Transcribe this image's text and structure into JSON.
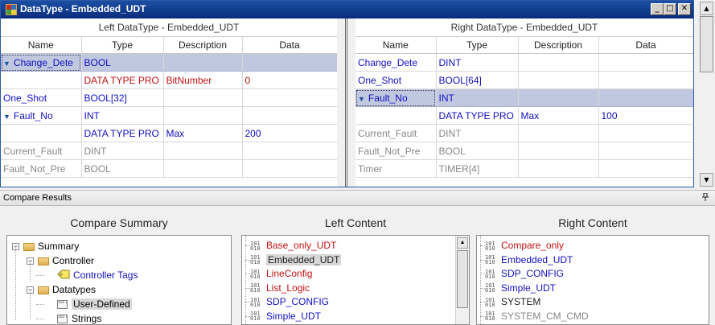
{
  "window": {
    "title": "DataType - Embedded_UDT",
    "minimize_label": "_",
    "maximize_label": "□",
    "close_label": "✕"
  },
  "left_panel": {
    "header": "Left DataType - Embedded_UDT",
    "columns": [
      "Name",
      "Type",
      "Description",
      "Data"
    ],
    "rows": [
      {
        "name": "Change_Dete",
        "type": "BOOL",
        "description": "",
        "data": "",
        "expanded": true,
        "selected": true,
        "color": "blue"
      },
      {
        "name": "",
        "type": "DATA TYPE PRO",
        "description": "BitNumber",
        "data": "0",
        "color": "red"
      },
      {
        "name": "One_Shot",
        "type": "BOOL[32]",
        "description": "",
        "data": "",
        "color": "blue"
      },
      {
        "name": "Fault_No",
        "type": "INT",
        "description": "",
        "data": "",
        "expanded": true,
        "color": "blue"
      },
      {
        "name": "",
        "type": "DATA TYPE PRO",
        "description": "Max",
        "data": "200",
        "color": "blue"
      },
      {
        "name": "Current_Fault",
        "type": "DINT",
        "description": "",
        "data": "",
        "color": "gray"
      },
      {
        "name": "Fault_Not_Pre",
        "type": "BOOL",
        "description": "",
        "data": "",
        "color": "gray"
      }
    ]
  },
  "right_panel": {
    "header": "Right DataType - Embedded_UDT",
    "columns": [
      "Name",
      "Type",
      "Description",
      "Data"
    ],
    "rows": [
      {
        "name": "Change_Dete",
        "type": "DINT",
        "description": "",
        "data": "",
        "color": "blue"
      },
      {
        "name": "One_Shot",
        "type": "BOOL[64]",
        "description": "",
        "data": "",
        "color": "blue"
      },
      {
        "name": "Fault_No",
        "type": "INT",
        "description": "",
        "data": "",
        "expanded": true,
        "selected": true,
        "color": "blue"
      },
      {
        "name": "",
        "type": "DATA TYPE PRO",
        "description": "Max",
        "data": "100",
        "color": "blue"
      },
      {
        "name": "Current_Fault",
        "type": "DINT",
        "description": "",
        "data": "",
        "color": "gray"
      },
      {
        "name": "Fault_Not_Pre",
        "type": "BOOL",
        "description": "",
        "data": "",
        "color": "gray"
      },
      {
        "name": "Timer",
        "type": "TIMER[4]",
        "description": "",
        "data": "",
        "color": "gray"
      }
    ]
  },
  "compare_results": {
    "pane_title": "Compare Results",
    "pin_icon": "pin-icon",
    "summary_header": "Compare Summary",
    "left_header": "Left Content",
    "right_header": "Right Content",
    "summary_tree": [
      {
        "label": "Summary",
        "level": 0,
        "icon": "folder-icon",
        "toggle": "−"
      },
      {
        "label": "Controller",
        "level": 1,
        "icon": "folder-icon",
        "toggle": "−"
      },
      {
        "label": "Controller Tags",
        "level": 2,
        "icon": "tag-icon",
        "color": "blue"
      },
      {
        "label": "Datatypes",
        "level": 1,
        "icon": "folder-icon",
        "toggle": "−"
      },
      {
        "label": "User-Defined",
        "level": 2,
        "icon": "datatype-icon",
        "selected": true
      },
      {
        "label": "Strings",
        "level": 2,
        "icon": "datatype-icon"
      }
    ],
    "left_content": [
      {
        "label": "Base_only_UDT",
        "color": "red"
      },
      {
        "label": "Embedded_UDT",
        "color": "black",
        "selected": true
      },
      {
        "label": "LineConfig",
        "color": "red"
      },
      {
        "label": "List_Logic",
        "color": "red"
      },
      {
        "label": "SDP_CONFIG",
        "color": "blue"
      },
      {
        "label": "Simple_UDT",
        "color": "blue"
      }
    ],
    "right_content": [
      {
        "label": "Compare_only",
        "color": "red"
      },
      {
        "label": "Embedded_UDT",
        "color": "blue"
      },
      {
        "label": "SDP_CONFIG",
        "color": "blue"
      },
      {
        "label": "Simple_UDT",
        "color": "blue"
      },
      {
        "label": "SYSTEM",
        "color": "black"
      },
      {
        "label": "SYSTEM_CM_CMD",
        "color": "gray"
      }
    ],
    "binary_glyph": "101\n010"
  },
  "colors": {
    "titlebar": "#0a2c7c",
    "selected_row": "#c0c8e0",
    "diff_red": "#c01010",
    "match_blue": "#1010c0",
    "unchanged_gray": "#888888"
  }
}
